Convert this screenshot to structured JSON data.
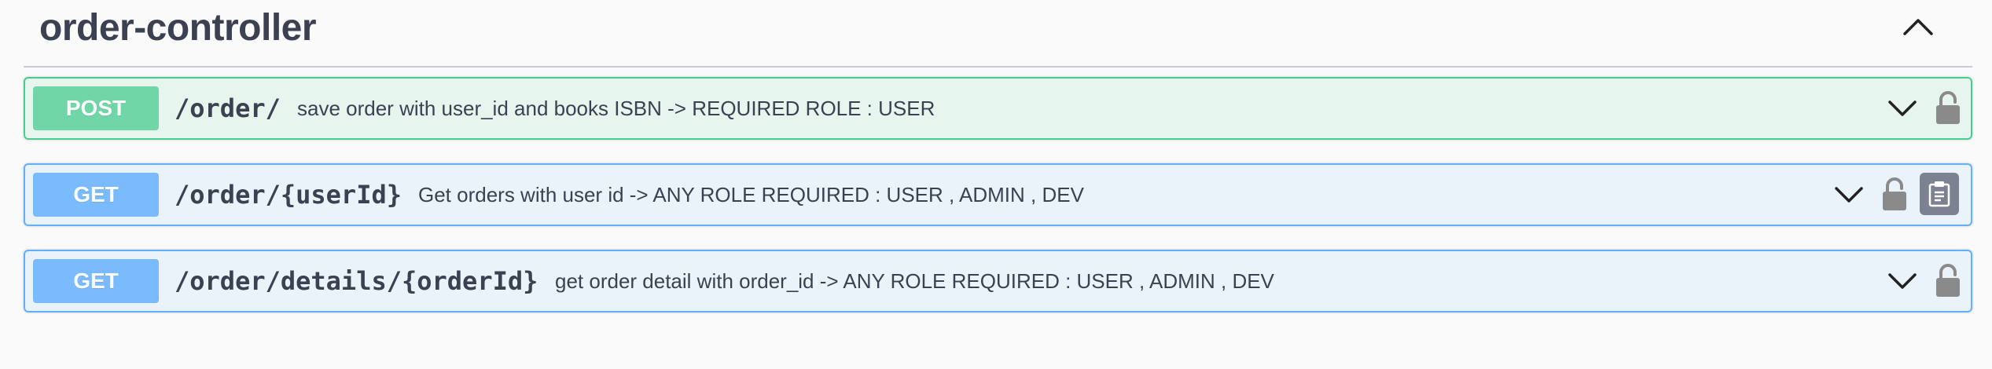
{
  "section": {
    "title": "order-controller",
    "collapse_icon": "chevron-up-icon"
  },
  "operations": [
    {
      "method": "POST",
      "path": "/order/",
      "summary": "save order with user_id and books ISBN -> REQUIRED ROLE : USER",
      "icons": [
        "chevron-down-icon",
        "lock-icon"
      ]
    },
    {
      "method": "GET",
      "path": "/order/{userId}",
      "summary": "Get orders with user id -> ANY ROLE REQUIRED : USER , ADMIN , DEV",
      "icons": [
        "chevron-down-icon",
        "lock-icon",
        "copy-to-clipboard-icon"
      ]
    },
    {
      "method": "GET",
      "path": "/order/details/{orderId}",
      "summary": "get order detail with order_id -> ANY ROLE REQUIRED : USER , ADMIN , DEV",
      "icons": [
        "chevron-down-icon",
        "lock-icon"
      ]
    }
  ],
  "colors": {
    "post": "#49cc90",
    "get": "#61affe",
    "text": "#3b4151",
    "icon": "#8a8a8a"
  }
}
